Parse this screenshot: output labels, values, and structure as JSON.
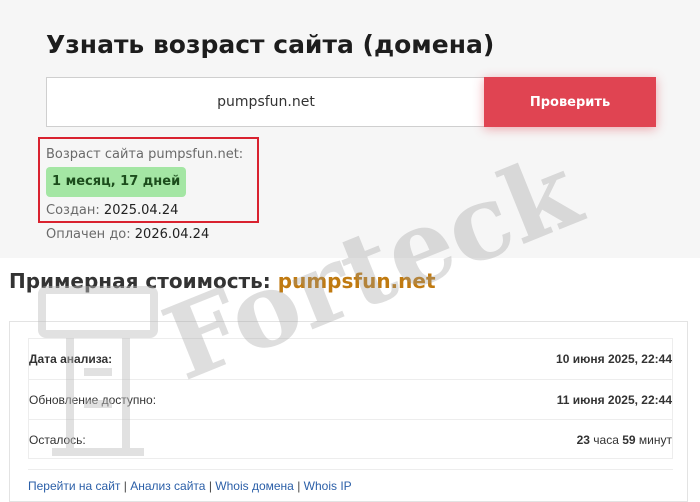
{
  "header": {
    "title": "Узнать возраст сайта (домена)"
  },
  "search": {
    "value": "pumpsfun.net",
    "button_label": "Проверить"
  },
  "result": {
    "age_label": "Возраст сайта pumpsfun.net:",
    "age_value": "1 месяц, 17 дней",
    "created_label": "Создан:",
    "created_value": "2025.04.24",
    "paid_label": "Оплачен до:",
    "paid_value": "2026.04.24"
  },
  "price": {
    "heading_prefix": "Примерная стоимость:",
    "heading_domain": "pumpsfun.net"
  },
  "card": {
    "rows": [
      {
        "label": "Дата анализа:",
        "value": "10 июня 2025, 22:44"
      },
      {
        "label": "Обновление доступно:",
        "value": "11 июня 2025, 22:44"
      },
      {
        "label": "Осталось:",
        "value_hours": "23",
        "value_hours_unit": "часа",
        "value_minutes": "59",
        "value_minutes_unit": "минут"
      }
    ],
    "links": [
      "Перейти на сайт",
      "Анализ сайта",
      "Whois домена",
      "Whois IP"
    ]
  },
  "watermark": {
    "text": "Forteck"
  },
  "colors": {
    "accent_button": "#e04452",
    "highlight_border": "#d9222f",
    "badge_bg": "#a4e6a4",
    "link": "#2b5fa8",
    "domain_accent": "#c07a10"
  }
}
